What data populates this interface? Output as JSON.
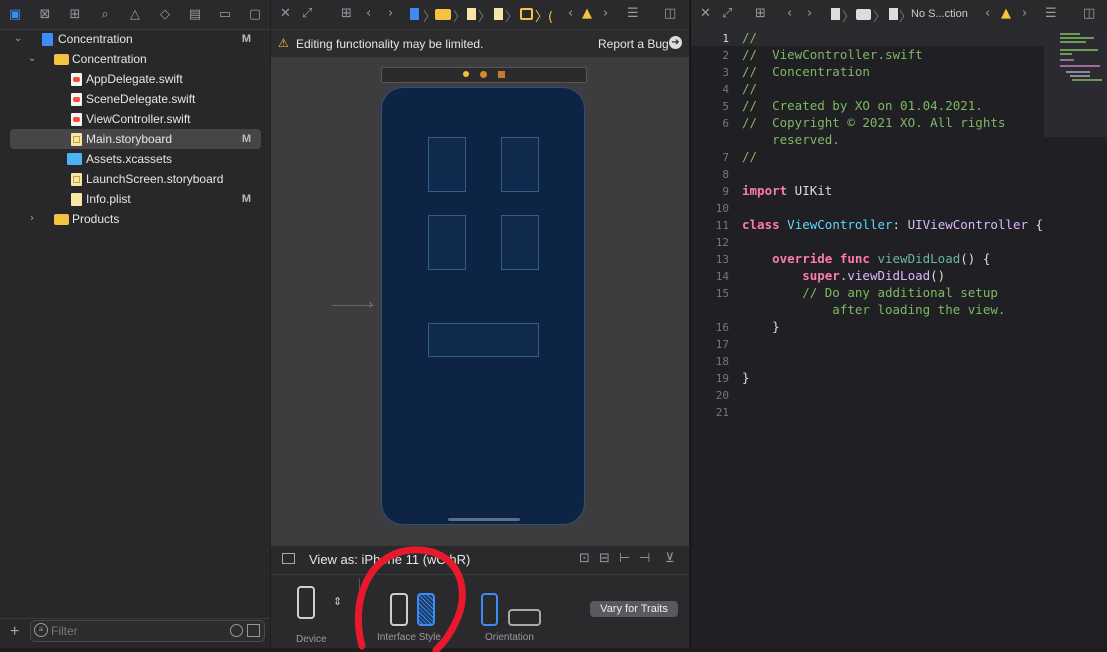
{
  "navigator": {
    "rows": [
      {
        "label": "Concentration",
        "badge": "M"
      },
      {
        "label": "Concentration",
        "badge": ""
      },
      {
        "label": "AppDelegate.swift",
        "badge": ""
      },
      {
        "label": "SceneDelegate.swift",
        "badge": ""
      },
      {
        "label": "ViewController.swift",
        "badge": ""
      },
      {
        "label": "Main.storyboard",
        "badge": "M"
      },
      {
        "label": "Assets.xcassets",
        "badge": ""
      },
      {
        "label": "LaunchScreen.storyboard",
        "badge": ""
      },
      {
        "label": "Info.plist",
        "badge": "M"
      },
      {
        "label": "Products",
        "badge": ""
      }
    ],
    "filter_placeholder": "Filter"
  },
  "canvas_editor": {
    "warning": "Editing functionality may be limited.",
    "report_bug": "Report a Bug",
    "view_as": "View as: iPhone 11 (wC hR)",
    "traits": {
      "device_label": "Device",
      "interface_style_label": "Interface Style",
      "orientation_label": "Orientation",
      "vary_button": "Vary for Traits"
    }
  },
  "code_editor": {
    "breadcrumb_last": "No S...ction",
    "lines": [
      {
        "n": "1",
        "text": "//"
      },
      {
        "n": "2",
        "text": "//  ViewController.swift"
      },
      {
        "n": "3",
        "text": "//  Concentration"
      },
      {
        "n": "4",
        "text": "//"
      },
      {
        "n": "5",
        "text": "//  Created by XO on 01.04.2021."
      },
      {
        "n": "6",
        "text": "//  Copyright © 2021 XO. All rights"
      },
      {
        "n": "",
        "text": "    reserved."
      },
      {
        "n": "7",
        "text": "//"
      },
      {
        "n": "8",
        "text": ""
      },
      {
        "n": "9",
        "kw": "import",
        "rest": " UIKit"
      },
      {
        "n": "10",
        "text": ""
      },
      {
        "n": "11",
        "kw": "class",
        "name": " ViewController",
        "punct": ": ",
        "type": "UIViewController",
        "tail": " {"
      },
      {
        "n": "12",
        "text": ""
      },
      {
        "n": "13",
        "kw": "    override func",
        "name": " viewDidLoad",
        "tail": "() {"
      },
      {
        "n": "14",
        "kw": "        super",
        "name": ".viewDidLoad",
        "tail": "()"
      },
      {
        "n": "15",
        "text": "        // Do any additional setup"
      },
      {
        "n": "",
        "text": "            after loading the view."
      },
      {
        "n": "16",
        "tail": "    }"
      },
      {
        "n": "17",
        "text": ""
      },
      {
        "n": "18",
        "text": ""
      },
      {
        "n": "19",
        "tail": "}"
      },
      {
        "n": "20",
        "text": ""
      },
      {
        "n": "21",
        "text": ""
      }
    ]
  }
}
